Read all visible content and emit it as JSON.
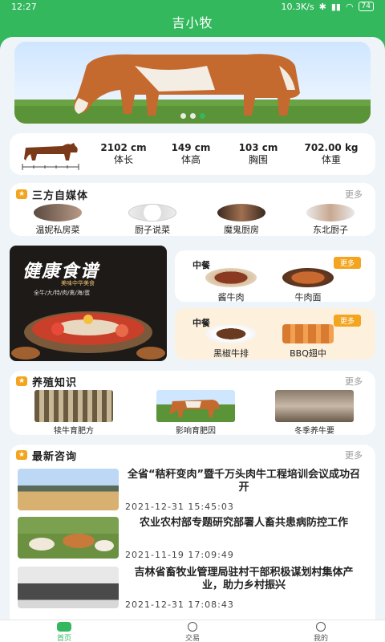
{
  "status": {
    "time": "12:27",
    "network": "10.3K/s",
    "battery": "74"
  },
  "app": {
    "title": "吉小牧"
  },
  "banner": {
    "dots": 3,
    "active_dot": 2
  },
  "stats": {
    "items": [
      {
        "value": "2102 cm",
        "label": "体长"
      },
      {
        "value": "149 cm",
        "label": "体高"
      },
      {
        "value": "103 cm",
        "label": "胸围"
      },
      {
        "value": "702.00 kg",
        "label": "体重"
      }
    ]
  },
  "media": {
    "title": "三方自媒体",
    "more": "更多",
    "items": [
      {
        "label": "温妮私房菜"
      },
      {
        "label": "厨子说菜"
      },
      {
        "label": "魔鬼厨房"
      },
      {
        "label": "东北厨子"
      }
    ]
  },
  "poster": {
    "title": "健康食谱",
    "subtitle": "美味中华美食",
    "tags": "全牛/大/特/肉/禽/海/蛋"
  },
  "recipes": [
    {
      "title": "中餐",
      "more": "更多",
      "dishes": [
        {
          "label": "酱牛肉"
        },
        {
          "label": "牛肉面"
        }
      ]
    },
    {
      "title": "中餐",
      "more": "更多",
      "dishes": [
        {
          "label": "黑椒牛排"
        },
        {
          "label": "BBQ翅中"
        }
      ]
    }
  ],
  "knowledge": {
    "title": "养殖知识",
    "more": "更多",
    "items": [
      {
        "label": "犊牛育肥方"
      },
      {
        "label": "影响育肥因"
      },
      {
        "label": "冬季养牛要"
      }
    ]
  },
  "news": {
    "title": "最新咨询",
    "more": "更多",
    "items": [
      {
        "title": "全省“秸秆变肉”暨千万头肉牛工程培训会议成功召开",
        "date": "2021-12-31 15:45:03"
      },
      {
        "title": "农业农村部专题研究部署人畜共患病防控工作",
        "date": "2021-11-19 17:09:49"
      },
      {
        "title": "吉林省畜牧业管理局驻村干部积极谋划村集体产业，助力乡村振兴",
        "date": "2021-12-31 17:08:43"
      }
    ]
  },
  "tabs": [
    {
      "label": "首页"
    },
    {
      "label": "交易"
    },
    {
      "label": "我的"
    }
  ],
  "colors": {
    "primary": "#34b85e",
    "accent": "#f3a520",
    "background": "#eef4f8"
  }
}
